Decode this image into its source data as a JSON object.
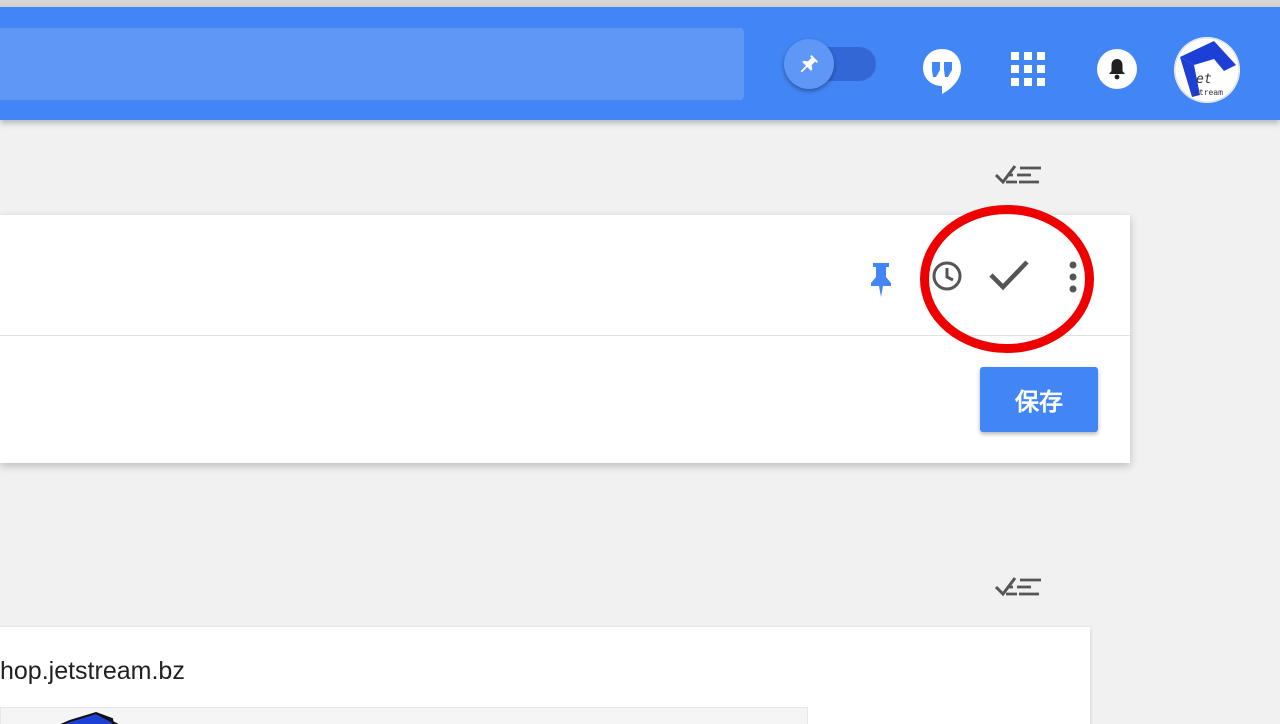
{
  "header": {
    "brand_color": "#4285f4",
    "search_value": "",
    "icons": [
      "pin-toggle-icon",
      "hangouts-icon",
      "apps-grid-icon",
      "notifications-bell-icon",
      "avatar-jetstream"
    ]
  },
  "note_card": {
    "save_label": "保存",
    "icons": [
      "pin-icon",
      "reminder-clock-icon",
      "mark-done-check-icon",
      "more-vert-icon"
    ]
  },
  "link_card": {
    "url_text": "hop.jetstream.bz"
  },
  "annotation": {
    "highlight_color": "#ee0000"
  }
}
